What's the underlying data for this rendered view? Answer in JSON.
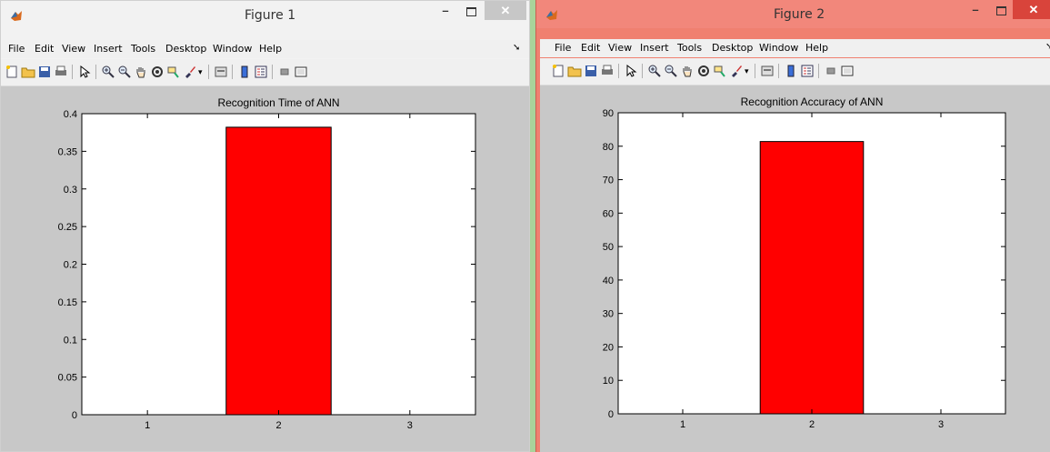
{
  "colors": {
    "bar": "#ff0000",
    "axes_bg": "#ffffff",
    "figure_bg": "#c8c8c8",
    "title_active": "#f2877b"
  },
  "windows": [
    {
      "title": "Figure 1",
      "menu": [
        "File",
        "Edit",
        "View",
        "Insert",
        "Tools",
        "Desktop",
        "Window",
        "Help"
      ],
      "toolbar_icons": [
        "new-file-icon",
        "open-folder-icon",
        "save-icon",
        "print-icon",
        "pointer-icon",
        "zoom-in-icon",
        "zoom-out-icon",
        "pan-hand-icon",
        "rotate-3d-icon",
        "data-cursor-icon",
        "brush-icon",
        "link-plot-icon",
        "colorbar-icon",
        "legend-icon",
        "hide-plot-tools-icon",
        "show-plot-tools-icon"
      ],
      "chart_data": {
        "type": "bar",
        "title": "Recognition Time of ANN",
        "categories": [
          "1",
          "2",
          "3"
        ],
        "values": [
          0,
          0.382,
          0
        ],
        "ylim": [
          0,
          0.4
        ],
        "xlim": [
          0.5,
          3.5
        ],
        "yticks": [
          "0",
          "0.05",
          "0.1",
          "0.15",
          "0.2",
          "0.25",
          "0.3",
          "0.35",
          "0.4"
        ],
        "xlabel": "",
        "ylabel": "",
        "grid": false
      }
    },
    {
      "title": "Figure 2",
      "menu": [
        "File",
        "Edit",
        "View",
        "Insert",
        "Tools",
        "Desktop",
        "Window",
        "Help"
      ],
      "toolbar_icons": [
        "new-file-icon",
        "open-folder-icon",
        "save-icon",
        "print-icon",
        "pointer-icon",
        "zoom-in-icon",
        "zoom-out-icon",
        "pan-hand-icon",
        "rotate-3d-icon",
        "data-cursor-icon",
        "brush-icon",
        "link-plot-icon",
        "colorbar-icon",
        "legend-icon",
        "hide-plot-tools-icon",
        "show-plot-tools-icon"
      ],
      "chart_data": {
        "type": "bar",
        "title": "Recognition Accuracy of ANN",
        "categories": [
          "1",
          "2",
          "3"
        ],
        "values": [
          0,
          81.4,
          0
        ],
        "ylim": [
          0,
          90
        ],
        "xlim": [
          0.5,
          3.5
        ],
        "yticks": [
          "0",
          "10",
          "20",
          "30",
          "40",
          "50",
          "60",
          "70",
          "80",
          "90"
        ],
        "xlabel": "",
        "ylabel": "",
        "grid": false
      }
    }
  ]
}
